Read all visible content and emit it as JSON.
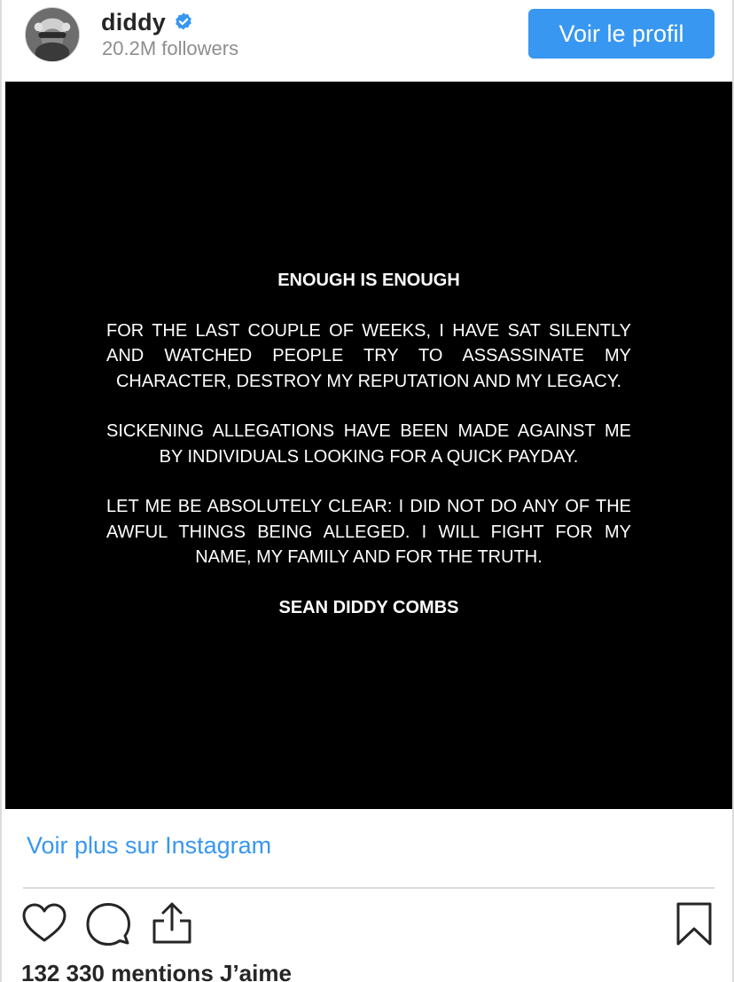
{
  "header": {
    "username": "diddy",
    "verified": true,
    "followers": "20.2M followers",
    "profile_button": "Voir le profil"
  },
  "post": {
    "title": "ENOUGH IS ENOUGH",
    "paragraphs": [
      "FOR THE LAST COUPLE OF WEEKS, I HAVE SAT SILENTLY AND WATCHED PEOPLE TRY TO ASSASSINATE MY CHARACTER, DESTROY MY REPUTATION AND MY LEGACY.",
      "SICKENING ALLEGATIONS HAVE BEEN MADE AGAINST ME BY INDIVIDUALS LOOKING FOR A QUICK PAYDAY.",
      "LET ME BE ABSOLUTELY CLEAR: I DID NOT DO ANY OF THE AWFUL THINGS BEING ALLEGED. I WILL FIGHT FOR MY NAME, MY FAMILY AND FOR THE TRUTH."
    ],
    "signature": "SEAN DIDDY COMBS"
  },
  "footer": {
    "more_link": "Voir plus sur Instagram",
    "likes": "132 330 mentions J’aime"
  },
  "icons": {
    "like": "heart-icon",
    "comment": "comment-icon",
    "share": "share-icon",
    "save": "bookmark-icon",
    "verified": "verified-badge-icon"
  },
  "colors": {
    "accent": "#3897f0",
    "text": "#262626",
    "muted": "#8e8e8e",
    "post_background": "#000000"
  }
}
